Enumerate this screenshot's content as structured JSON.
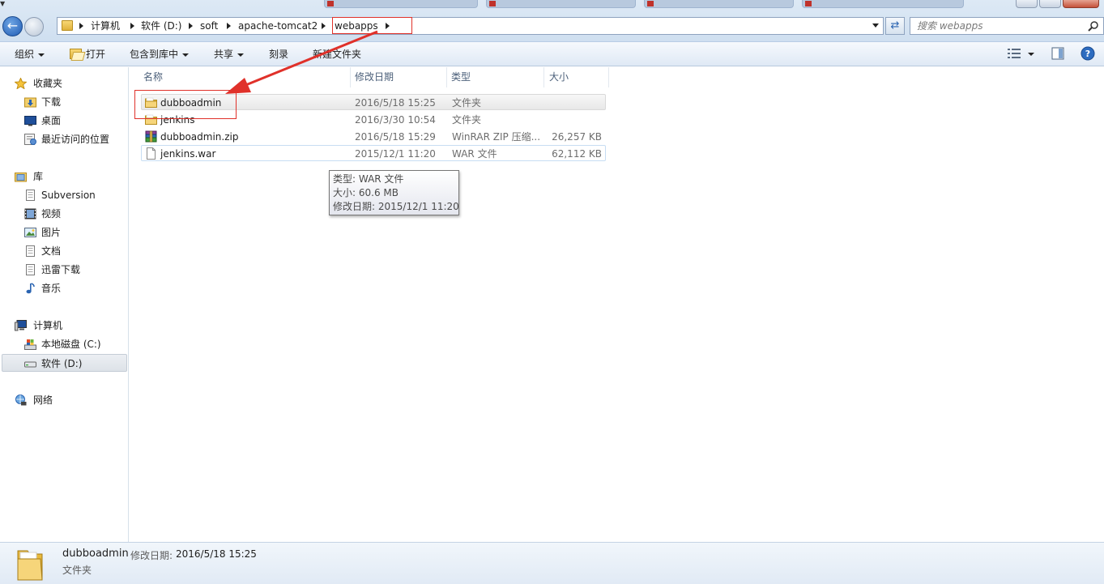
{
  "address_bar": {
    "segments": [
      "计算机",
      "软件 (D:)",
      "soft",
      "apache-tomcat2",
      "webapps"
    ]
  },
  "search": {
    "placeholder": "搜索 webapps"
  },
  "toolbar": {
    "organize": "组织",
    "open": "打开",
    "include_in_library": "包含到库中",
    "share": "共享",
    "burn": "刻录",
    "new_folder": "新建文件夹"
  },
  "nav": {
    "favorites": {
      "label": "收藏夹",
      "items": [
        "下载",
        "桌面",
        "最近访问的位置"
      ]
    },
    "libraries": {
      "label": "库",
      "items": [
        "Subversion",
        "视频",
        "图片",
        "文档",
        "迅雷下载",
        "音乐"
      ]
    },
    "computer": {
      "label": "计算机",
      "items": [
        "本地磁盘 (C:)",
        "软件 (D:)"
      ]
    },
    "network": {
      "label": "网络"
    }
  },
  "columns": {
    "name": "名称",
    "date": "修改日期",
    "type": "类型",
    "size": "大小"
  },
  "files": [
    {
      "name": "dubboadmin",
      "date": "2016/5/18 15:25",
      "type": "文件夹",
      "size": "",
      "icon": "folder-icon"
    },
    {
      "name": "jenkins",
      "date": "2016/3/30 10:54",
      "type": "文件夹",
      "size": "",
      "icon": "folder-icon"
    },
    {
      "name": "dubboadmin.zip",
      "date": "2016/5/18 15:29",
      "type": "WinRAR ZIP 压缩...",
      "size": "26,257 KB",
      "icon": "winrar-archive-icon"
    },
    {
      "name": "jenkins.war",
      "date": "2015/12/1 11:20",
      "type": "WAR 文件",
      "size": "62,112 KB",
      "icon": "blank-file-icon"
    }
  ],
  "tooltip": {
    "type": "类型: WAR 文件",
    "size": "大小: 60.6 MB",
    "date": "修改日期: 2015/12/1 11:20"
  },
  "details": {
    "name": "dubboadmin",
    "date_label": "修改日期:",
    "date": "2016/5/18 15:25",
    "type": "文件夹"
  },
  "colors": {
    "annotation_red": "#e0312a",
    "accent_blue": "#2a64b1"
  }
}
